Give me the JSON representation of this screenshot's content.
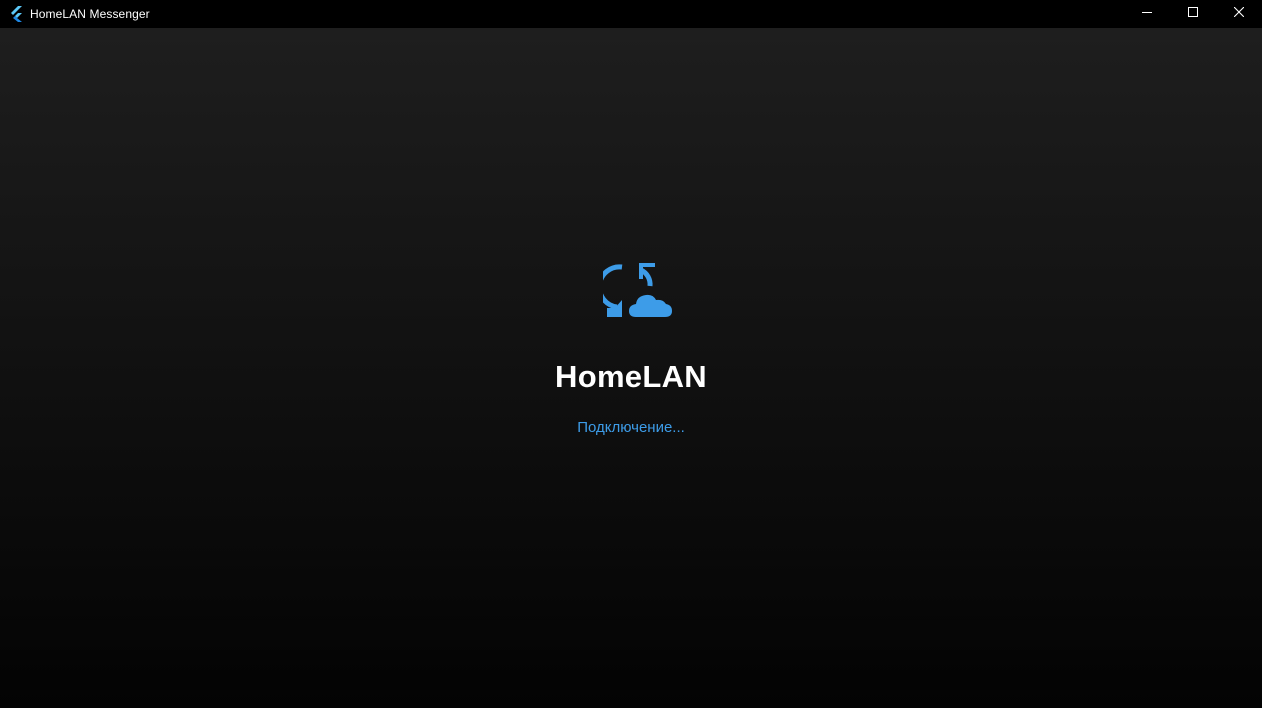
{
  "window": {
    "title": "HomeLAN Messenger",
    "app_icon": "flutter-icon",
    "controls": {
      "minimize": "minimize-icon",
      "maximize": "maximize-icon",
      "close": "close-icon"
    }
  },
  "splash": {
    "logo_icon": "cloud-sync-icon",
    "app_name": "HomeLAN",
    "status": "Подключение..."
  },
  "colors": {
    "accent": "#3d9ce8",
    "background_top": "#1e1e1e",
    "background_bottom": "#030303",
    "titlebar": "#000000",
    "text": "#ffffff"
  }
}
